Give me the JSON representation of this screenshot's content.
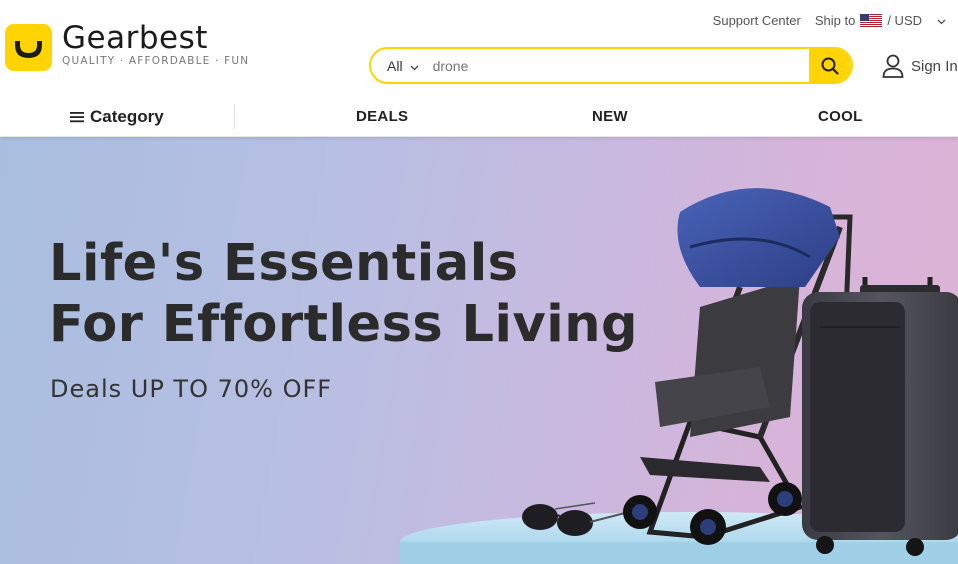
{
  "header": {
    "logo_word": "Gearbest",
    "logo_tagline": "QUALITY · AFFORDABLE · FUN",
    "support_label": "Support Center",
    "ship_label": "Ship to",
    "currency": "/ USD",
    "sign_in_label": "Sign In"
  },
  "search": {
    "category": "All",
    "placeholder": "drone"
  },
  "nav": {
    "category_label": "Category",
    "items": [
      "DEALS",
      "NEW",
      "COOL"
    ]
  },
  "banner": {
    "headline_line1": "Life's Essentials",
    "headline_line2": "For Effortless Living",
    "subheadline": "Deals UP TO 70% OFF"
  },
  "colors": {
    "brand": "#ffd400",
    "text_dark": "#2b2b2b"
  }
}
